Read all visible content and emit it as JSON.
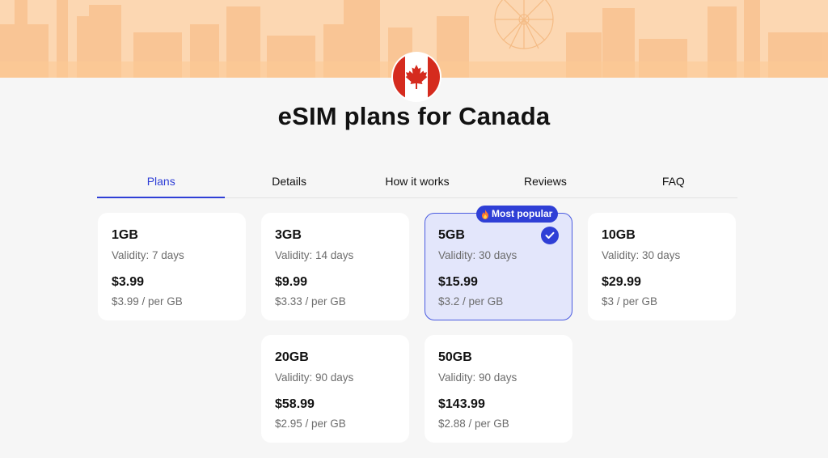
{
  "header": {
    "title": "eSIM plans for Canada",
    "flag_alt": "Canada flag"
  },
  "tabs": [
    {
      "label": "Plans",
      "active": true
    },
    {
      "label": "Details",
      "active": false
    },
    {
      "label": "How it works",
      "active": false
    },
    {
      "label": "Reviews",
      "active": false
    },
    {
      "label": "FAQ",
      "active": false
    }
  ],
  "plans": [
    {
      "size": "1GB",
      "validity": "Validity: 7 days",
      "price": "$3.99",
      "per_gb": "$3.99 / per GB"
    },
    {
      "size": "3GB",
      "validity": "Validity: 14 days",
      "price": "$9.99",
      "per_gb": "$3.33 / per GB"
    },
    {
      "size": "5GB",
      "validity": "Validity: 30 days",
      "price": "$15.99",
      "per_gb": "$3.2 / per GB",
      "badge": "Most popular",
      "selected": true
    },
    {
      "size": "10GB",
      "validity": "Validity: 30 days",
      "price": "$29.99",
      "per_gb": "$3 / per GB"
    },
    {
      "size": "20GB",
      "validity": "Validity: 90 days",
      "price": "$58.99",
      "per_gb": "$2.95 / per GB"
    },
    {
      "size": "50GB",
      "validity": "Validity: 90 days",
      "price": "$143.99",
      "per_gb": "$2.88 / per GB"
    }
  ],
  "colors": {
    "accent": "#2f3fd6",
    "banner": "#fcd7b2",
    "selected_card": "#e3e6fb",
    "flag_red": "#d52b1e"
  },
  "icons": {
    "badge_icon": "fire-icon",
    "selected_icon": "check-circle-icon"
  }
}
